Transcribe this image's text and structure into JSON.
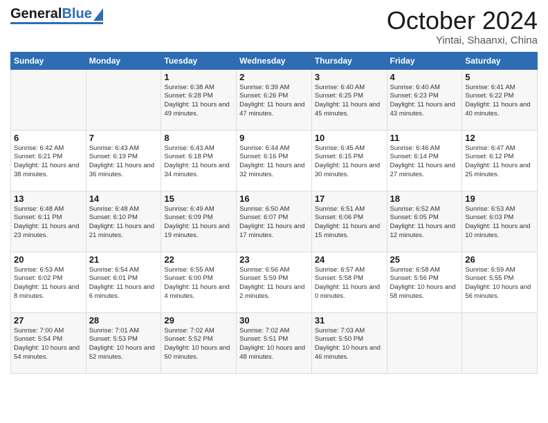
{
  "header": {
    "logo_general": "General",
    "logo_blue": "Blue",
    "month_title": "October 2024",
    "location": "Yintai, Shaanxi, China"
  },
  "days_of_week": [
    "Sunday",
    "Monday",
    "Tuesday",
    "Wednesday",
    "Thursday",
    "Friday",
    "Saturday"
  ],
  "weeks": [
    [
      {
        "day": "",
        "sunrise": "",
        "sunset": "",
        "daylight": ""
      },
      {
        "day": "",
        "sunrise": "",
        "sunset": "",
        "daylight": ""
      },
      {
        "day": "1",
        "sunrise": "Sunrise: 6:38 AM",
        "sunset": "Sunset: 6:28 PM",
        "daylight": "Daylight: 11 hours and 49 minutes."
      },
      {
        "day": "2",
        "sunrise": "Sunrise: 6:39 AM",
        "sunset": "Sunset: 6:26 PM",
        "daylight": "Daylight: 11 hours and 47 minutes."
      },
      {
        "day": "3",
        "sunrise": "Sunrise: 6:40 AM",
        "sunset": "Sunset: 6:25 PM",
        "daylight": "Daylight: 11 hours and 45 minutes."
      },
      {
        "day": "4",
        "sunrise": "Sunrise: 6:40 AM",
        "sunset": "Sunset: 6:23 PM",
        "daylight": "Daylight: 11 hours and 43 minutes."
      },
      {
        "day": "5",
        "sunrise": "Sunrise: 6:41 AM",
        "sunset": "Sunset: 6:22 PM",
        "daylight": "Daylight: 11 hours and 40 minutes."
      }
    ],
    [
      {
        "day": "6",
        "sunrise": "Sunrise: 6:42 AM",
        "sunset": "Sunset: 6:21 PM",
        "daylight": "Daylight: 11 hours and 38 minutes."
      },
      {
        "day": "7",
        "sunrise": "Sunrise: 6:43 AM",
        "sunset": "Sunset: 6:19 PM",
        "daylight": "Daylight: 11 hours and 36 minutes."
      },
      {
        "day": "8",
        "sunrise": "Sunrise: 6:43 AM",
        "sunset": "Sunset: 6:18 PM",
        "daylight": "Daylight: 11 hours and 34 minutes."
      },
      {
        "day": "9",
        "sunrise": "Sunrise: 6:44 AM",
        "sunset": "Sunset: 6:16 PM",
        "daylight": "Daylight: 11 hours and 32 minutes."
      },
      {
        "day": "10",
        "sunrise": "Sunrise: 6:45 AM",
        "sunset": "Sunset: 6:15 PM",
        "daylight": "Daylight: 11 hours and 30 minutes."
      },
      {
        "day": "11",
        "sunrise": "Sunrise: 6:46 AM",
        "sunset": "Sunset: 6:14 PM",
        "daylight": "Daylight: 11 hours and 27 minutes."
      },
      {
        "day": "12",
        "sunrise": "Sunrise: 6:47 AM",
        "sunset": "Sunset: 6:12 PM",
        "daylight": "Daylight: 11 hours and 25 minutes."
      }
    ],
    [
      {
        "day": "13",
        "sunrise": "Sunrise: 6:48 AM",
        "sunset": "Sunset: 6:11 PM",
        "daylight": "Daylight: 11 hours and 23 minutes."
      },
      {
        "day": "14",
        "sunrise": "Sunrise: 6:48 AM",
        "sunset": "Sunset: 6:10 PM",
        "daylight": "Daylight: 11 hours and 21 minutes."
      },
      {
        "day": "15",
        "sunrise": "Sunrise: 6:49 AM",
        "sunset": "Sunset: 6:09 PM",
        "daylight": "Daylight: 11 hours and 19 minutes."
      },
      {
        "day": "16",
        "sunrise": "Sunrise: 6:50 AM",
        "sunset": "Sunset: 6:07 PM",
        "daylight": "Daylight: 11 hours and 17 minutes."
      },
      {
        "day": "17",
        "sunrise": "Sunrise: 6:51 AM",
        "sunset": "Sunset: 6:06 PM",
        "daylight": "Daylight: 11 hours and 15 minutes."
      },
      {
        "day": "18",
        "sunrise": "Sunrise: 6:52 AM",
        "sunset": "Sunset: 6:05 PM",
        "daylight": "Daylight: 11 hours and 12 minutes."
      },
      {
        "day": "19",
        "sunrise": "Sunrise: 6:53 AM",
        "sunset": "Sunset: 6:03 PM",
        "daylight": "Daylight: 11 hours and 10 minutes."
      }
    ],
    [
      {
        "day": "20",
        "sunrise": "Sunrise: 6:53 AM",
        "sunset": "Sunset: 6:02 PM",
        "daylight": "Daylight: 11 hours and 8 minutes."
      },
      {
        "day": "21",
        "sunrise": "Sunrise: 6:54 AM",
        "sunset": "Sunset: 6:01 PM",
        "daylight": "Daylight: 11 hours and 6 minutes."
      },
      {
        "day": "22",
        "sunrise": "Sunrise: 6:55 AM",
        "sunset": "Sunset: 6:00 PM",
        "daylight": "Daylight: 11 hours and 4 minutes."
      },
      {
        "day": "23",
        "sunrise": "Sunrise: 6:56 AM",
        "sunset": "Sunset: 5:59 PM",
        "daylight": "Daylight: 11 hours and 2 minutes."
      },
      {
        "day": "24",
        "sunrise": "Sunrise: 6:57 AM",
        "sunset": "Sunset: 5:58 PM",
        "daylight": "Daylight: 11 hours and 0 minutes."
      },
      {
        "day": "25",
        "sunrise": "Sunrise: 6:58 AM",
        "sunset": "Sunset: 5:56 PM",
        "daylight": "Daylight: 10 hours and 58 minutes."
      },
      {
        "day": "26",
        "sunrise": "Sunrise: 6:59 AM",
        "sunset": "Sunset: 5:55 PM",
        "daylight": "Daylight: 10 hours and 56 minutes."
      }
    ],
    [
      {
        "day": "27",
        "sunrise": "Sunrise: 7:00 AM",
        "sunset": "Sunset: 5:54 PM",
        "daylight": "Daylight: 10 hours and 54 minutes."
      },
      {
        "day": "28",
        "sunrise": "Sunrise: 7:01 AM",
        "sunset": "Sunset: 5:53 PM",
        "daylight": "Daylight: 10 hours and 52 minutes."
      },
      {
        "day": "29",
        "sunrise": "Sunrise: 7:02 AM",
        "sunset": "Sunset: 5:52 PM",
        "daylight": "Daylight: 10 hours and 50 minutes."
      },
      {
        "day": "30",
        "sunrise": "Sunrise: 7:02 AM",
        "sunset": "Sunset: 5:51 PM",
        "daylight": "Daylight: 10 hours and 48 minutes."
      },
      {
        "day": "31",
        "sunrise": "Sunrise: 7:03 AM",
        "sunset": "Sunset: 5:50 PM",
        "daylight": "Daylight: 10 hours and 46 minutes."
      },
      {
        "day": "",
        "sunrise": "",
        "sunset": "",
        "daylight": ""
      },
      {
        "day": "",
        "sunrise": "",
        "sunset": "",
        "daylight": ""
      }
    ]
  ]
}
